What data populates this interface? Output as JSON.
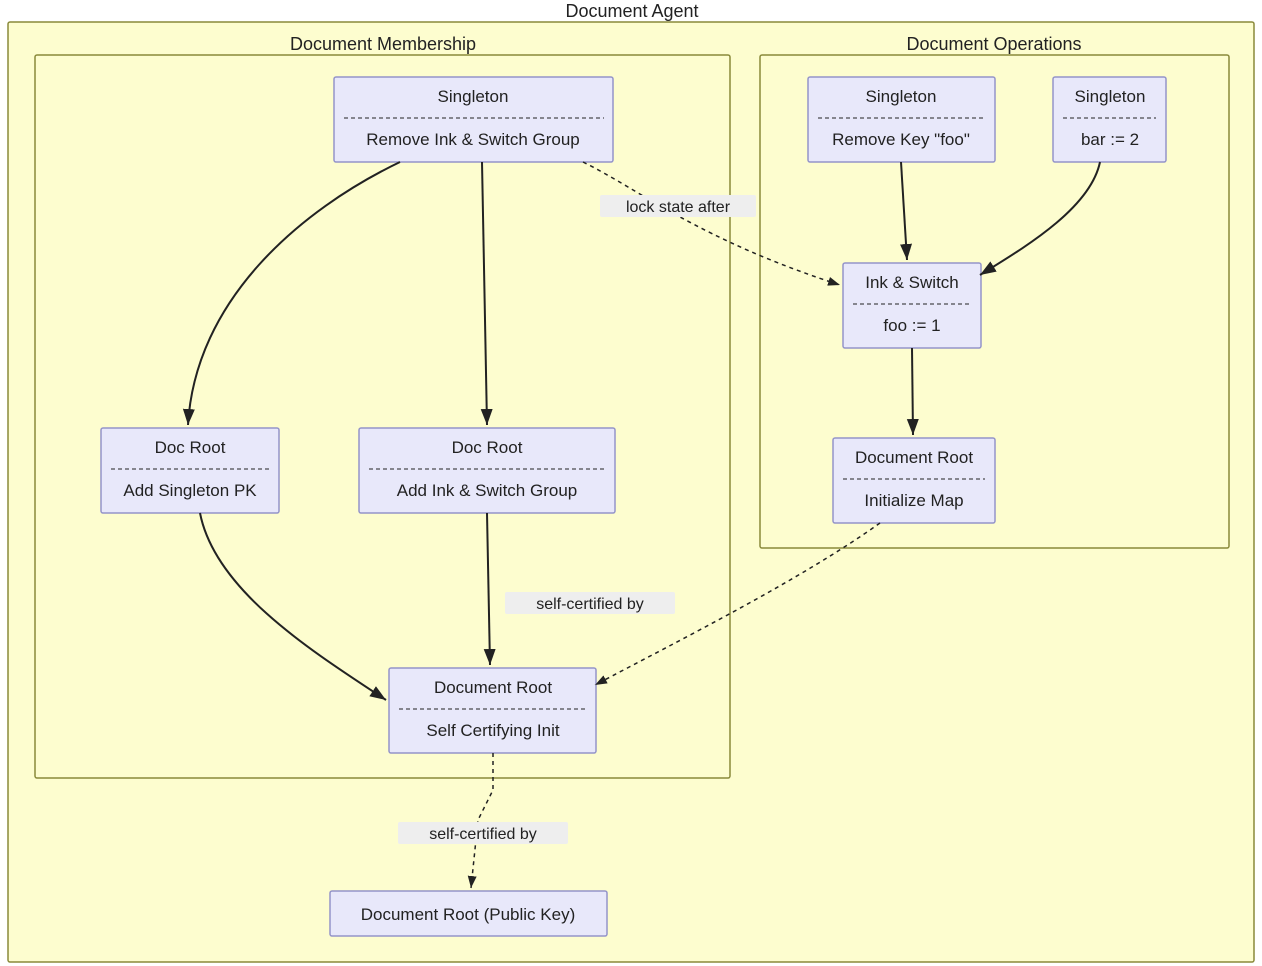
{
  "diagram": {
    "outer_title": "Document Agent",
    "membership": {
      "title": "Document Membership",
      "nodes": {
        "singleton": {
          "title": "Singleton",
          "body": "Remove Ink & Switch Group"
        },
        "docroot_pk": {
          "title": "Doc Root",
          "body": "Add Singleton PK"
        },
        "docroot_group": {
          "title": "Doc Root",
          "body": "Add Ink & Switch Group"
        },
        "docroot_init": {
          "title": "Document Root",
          "body": "Self Certifying Init"
        }
      }
    },
    "operations": {
      "title": "Document Operations",
      "nodes": {
        "singleton_remove": {
          "title": "Singleton",
          "body": "Remove Key \"foo\""
        },
        "singleton_bar": {
          "title": "Singleton",
          "body": "bar := 2"
        },
        "inkswitch": {
          "title": "Ink & Switch",
          "body": "foo := 1"
        },
        "docroot_map": {
          "title": "Document Root",
          "body": "Initialize Map"
        }
      }
    },
    "bottom_node": {
      "label": "Document Root (Public Key)"
    },
    "edge_labels": {
      "lock_state": "lock state after",
      "self_cert_1": "self-certified by",
      "self_cert_2": "self-certified by"
    }
  }
}
